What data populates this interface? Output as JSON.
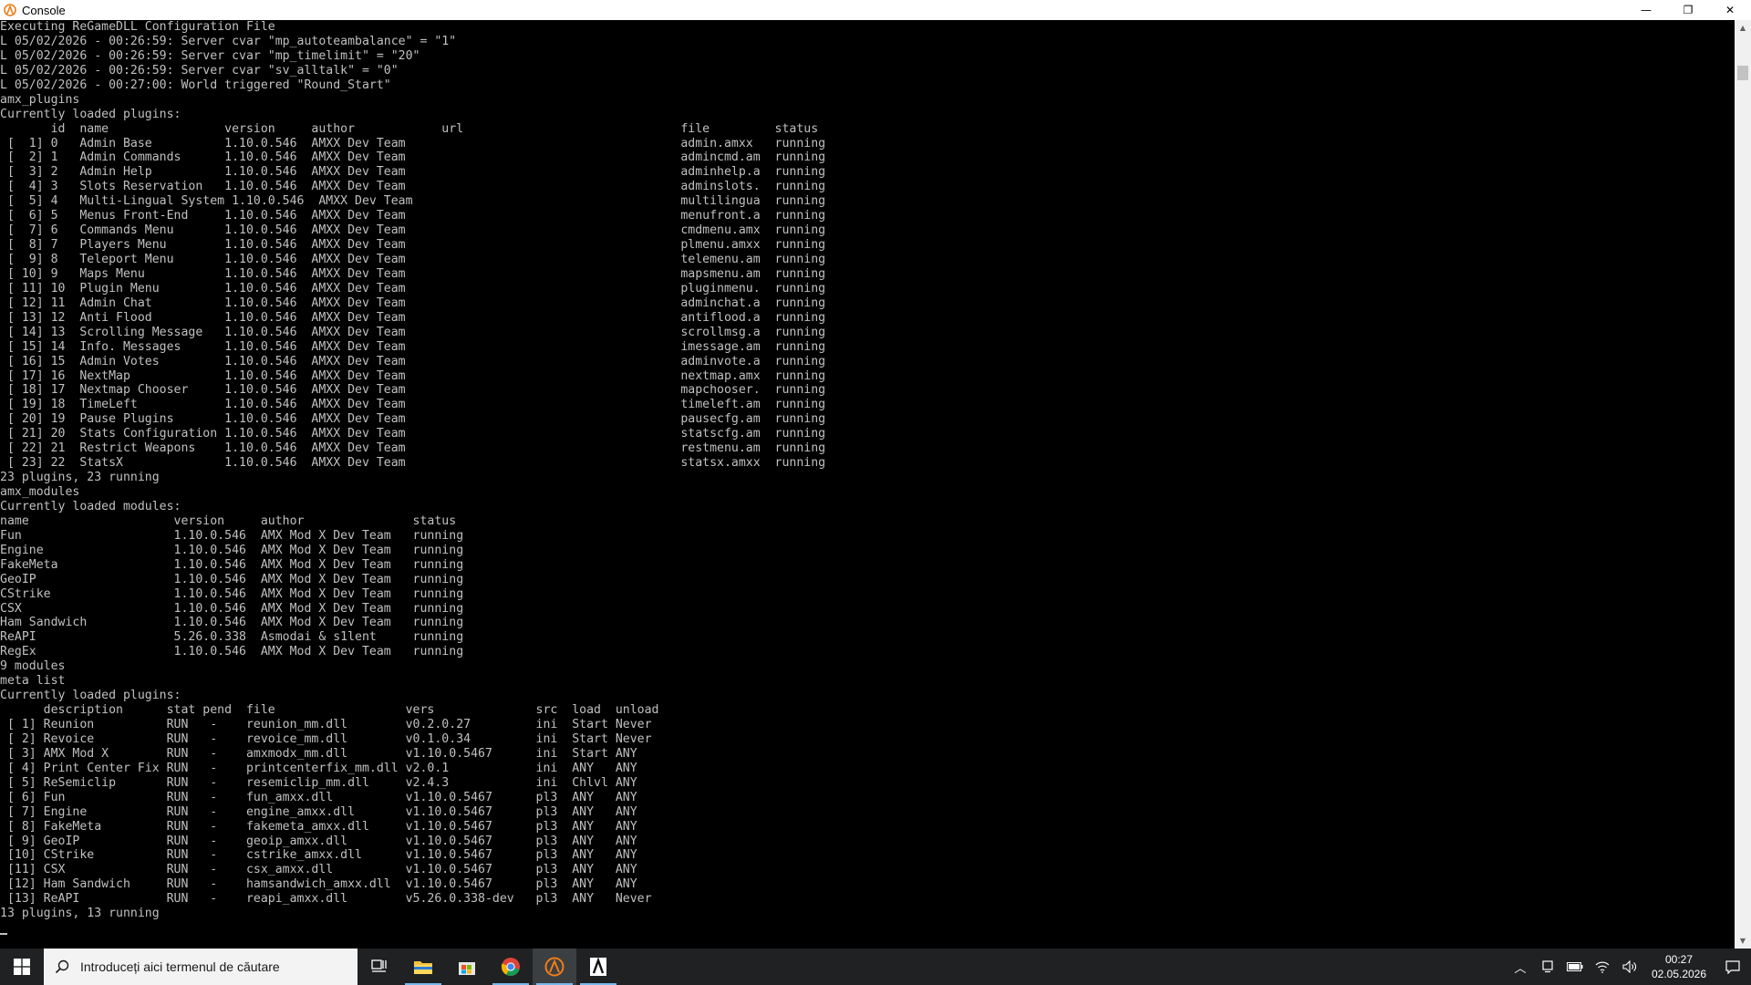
{
  "window": {
    "title": "Console",
    "minimize_glyph": "—",
    "restore_glyph": "❐",
    "close_glyph": "✕"
  },
  "console": {
    "lines": [
      "Executing ReGameDLL Configuration File",
      "L 05/02/2026 - 00:26:59: Server cvar \"mp_autoteambalance\" = \"1\"",
      "L 05/02/2026 - 00:26:59: Server cvar \"mp_timelimit\" = \"20\"",
      "L 05/02/2026 - 00:26:59: Server cvar \"sv_alltalk\" = \"0\"",
      "L 05/02/2026 - 00:27:00: World triggered \"Round_Start\"",
      "amx_plugins",
      "Currently loaded plugins:",
      "       id  name                version     author            url                              file         status",
      " [  1] 0   Admin Base          1.10.0.546  AMXX Dev Team                                      admin.amxx   running",
      " [  2] 1   Admin Commands      1.10.0.546  AMXX Dev Team                                      admincmd.am  running",
      " [  3] 2   Admin Help          1.10.0.546  AMXX Dev Team                                      adminhelp.a  running",
      " [  4] 3   Slots Reservation   1.10.0.546  AMXX Dev Team                                      adminslots.  running",
      " [  5] 4   Multi-Lingual System 1.10.0.546  AMXX Dev Team                                     multilingua  running",
      " [  6] 5   Menus Front-End     1.10.0.546  AMXX Dev Team                                      menufront.a  running",
      " [  7] 6   Commands Menu       1.10.0.546  AMXX Dev Team                                      cmdmenu.amx  running",
      " [  8] 7   Players Menu        1.10.0.546  AMXX Dev Team                                      plmenu.amxx  running",
      " [  9] 8   Teleport Menu       1.10.0.546  AMXX Dev Team                                      telemenu.am  running",
      " [ 10] 9   Maps Menu           1.10.0.546  AMXX Dev Team                                      mapsmenu.am  running",
      " [ 11] 10  Plugin Menu         1.10.0.546  AMXX Dev Team                                      pluginmenu.  running",
      " [ 12] 11  Admin Chat          1.10.0.546  AMXX Dev Team                                      adminchat.a  running",
      " [ 13] 12  Anti Flood          1.10.0.546  AMXX Dev Team                                      antiflood.a  running",
      " [ 14] 13  Scrolling Message   1.10.0.546  AMXX Dev Team                                      scrollmsg.a  running",
      " [ 15] 14  Info. Messages      1.10.0.546  AMXX Dev Team                                      imessage.am  running",
      " [ 16] 15  Admin Votes         1.10.0.546  AMXX Dev Team                                      adminvote.a  running",
      " [ 17] 16  NextMap             1.10.0.546  AMXX Dev Team                                      nextmap.amx  running",
      " [ 18] 17  Nextmap Chooser     1.10.0.546  AMXX Dev Team                                      mapchooser.  running",
      " [ 19] 18  TimeLeft            1.10.0.546  AMXX Dev Team                                      timeleft.am  running",
      " [ 20] 19  Pause Plugins       1.10.0.546  AMXX Dev Team                                      pausecfg.am  running",
      " [ 21] 20  Stats Configuration 1.10.0.546  AMXX Dev Team                                      statscfg.am  running",
      " [ 22] 21  Restrict Weapons    1.10.0.546  AMXX Dev Team                                      restmenu.am  running",
      " [ 23] 22  StatsX              1.10.0.546  AMXX Dev Team                                      statsx.amxx  running",
      "23 plugins, 23 running",
      "amx_modules",
      "Currently loaded modules:",
      "name                    version     author               status",
      "Fun                     1.10.0.546  AMX Mod X Dev Team   running",
      "Engine                  1.10.0.546  AMX Mod X Dev Team   running",
      "FakeMeta                1.10.0.546  AMX Mod X Dev Team   running",
      "GeoIP                   1.10.0.546  AMX Mod X Dev Team   running",
      "CStrike                 1.10.0.546  AMX Mod X Dev Team   running",
      "CSX                     1.10.0.546  AMX Mod X Dev Team   running",
      "Ham Sandwich            1.10.0.546  AMX Mod X Dev Team   running",
      "ReAPI                   5.26.0.338  Asmodai & s1lent     running",
      "RegEx                   1.10.0.546  AMX Mod X Dev Team   running",
      "9 modules",
      "meta list",
      "Currently loaded plugins:",
      "      description      stat pend  file                  vers              src  load  unload",
      " [ 1] Reunion          RUN   -    reunion_mm.dll        v0.2.0.27         ini  Start Never",
      " [ 2] Revoice          RUN   -    revoice_mm.dll        v0.1.0.34         ini  Start Never",
      " [ 3] AMX Mod X        RUN   -    amxmodx_mm.dll        v1.10.0.5467      ini  Start ANY",
      " [ 4] Print Center Fix RUN   -    printcenterfix_mm.dll v2.0.1            ini  ANY   ANY",
      " [ 5] ReSemiclip       RUN   -    resemiclip_mm.dll     v2.4.3            ini  Chlvl ANY",
      " [ 6] Fun              RUN   -    fun_amxx.dll          v1.10.0.5467      pl3  ANY   ANY",
      " [ 7] Engine           RUN   -    engine_amxx.dll       v1.10.0.5467      pl3  ANY   ANY",
      " [ 8] FakeMeta         RUN   -    fakemeta_amxx.dll     v1.10.0.5467      pl3  ANY   ANY",
      " [ 9] GeoIP            RUN   -    geoip_amxx.dll        v1.10.0.5467      pl3  ANY   ANY",
      " [10] CStrike          RUN   -    cstrike_amxx.dll      v1.10.0.5467      pl3  ANY   ANY",
      " [11] CSX              RUN   -    csx_amxx.dll          v1.10.0.5467      pl3  ANY   ANY",
      " [12] Ham Sandwich     RUN   -    hamsandwich_amxx.dll  v1.10.0.5467      pl3  ANY   ANY",
      " [13] ReAPI            RUN   -    reapi_amxx.dll        v5.26.0.338-dev   pl3  ANY   Never",
      "13 plugins, 13 running"
    ]
  },
  "taskbar": {
    "search_placeholder": "Introduceți aici termenul de căutare",
    "apps": [
      {
        "name": "task-view",
        "icon": "task-view-icon"
      },
      {
        "name": "file-explorer",
        "icon": "folder-icon"
      },
      {
        "name": "store",
        "icon": "store-icon"
      },
      {
        "name": "chrome",
        "icon": "chrome-icon"
      },
      {
        "name": "hlds-console",
        "icon": "half-life-icon",
        "active": true
      },
      {
        "name": "amx-app",
        "icon": "amx-icon"
      }
    ],
    "clock": {
      "time": "00:27",
      "date": "02.05.2026"
    }
  },
  "colors": {
    "console_bg": "#000000",
    "console_text": "#c0c0c0",
    "taskbar_bg": "#1f2123",
    "hl_orange": "#f07d17"
  }
}
